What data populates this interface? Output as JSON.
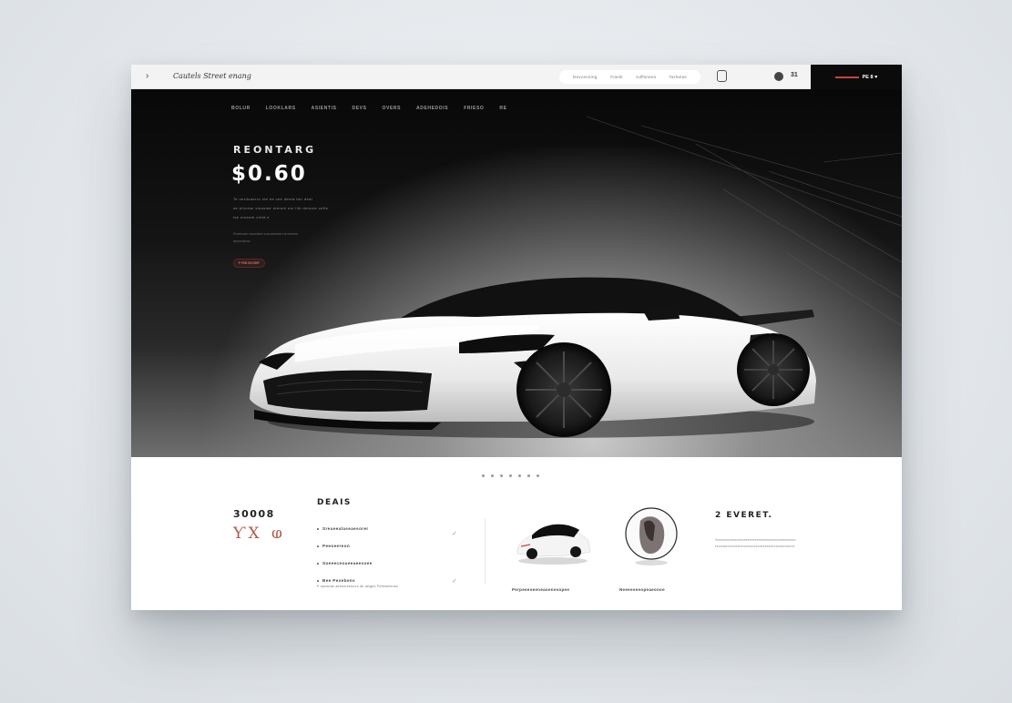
{
  "topbar": {
    "brand": "Cautels Street enang",
    "menu_icon": "chevron-right",
    "tabs": [
      "Devcensing",
      "Tranik",
      "Adlfsnees",
      "Tarhelas"
    ],
    "count": "31",
    "cta_label": "PE 8 ♥"
  },
  "hero": {
    "nav": [
      "BOLUR",
      "LOOKLARS",
      "ASIENTIS",
      "DEVS",
      "OVERS",
      "ADEHEDOIS",
      "FRIESO",
      "RE"
    ],
    "kicker": "REONTARG",
    "price": "$0.60",
    "text_lines": [
      "Te uerdoaerre ote ee cee deeta ber deal",
      "ae eilcotar sloosme drenee eor ille denone cefte",
      "tse elceute cletd e"
    ],
    "sub_lines": [
      "Peneenalor evoneelere eoocoesertoe ere eeeeree",
      "seoeeroleroe"
    ],
    "button_label": "P PEB DECREF"
  },
  "bottom": {
    "stat_number": "30008",
    "stat_sign": "ƳX ⱷ",
    "deals_title": "DEAIS",
    "deals": [
      "Sreueealaseaesorer",
      "Peeoeereon",
      "Soeeeceoueeaeesoee",
      "Bee Pesebens"
    ],
    "deal_note": "P aoeeeae aeeeereeeneo db deigee Pellebelenee",
    "product1_caption": "Perpeeeoeeneaoenesopee",
    "product2_caption": "Neeeeoeeopeaeonoe",
    "events_title": "2 EVERET.",
    "events_lines": [
      "Seeeeeoeoeeeeeeseeeeeeeeeeeeeeeoeeoeeeeeseeeo",
      "eeceoeerenenelerereresesoeeeeeeeeelreeeeseoeeree"
    ]
  },
  "colors": {
    "accent": "#c8463a",
    "hero_bg": "#0b0b0b",
    "page_bg": "#e4e8ec"
  }
}
